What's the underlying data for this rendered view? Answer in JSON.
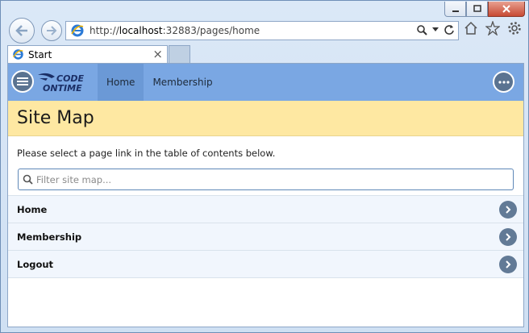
{
  "browser": {
    "url_prefix": "http://",
    "url_host": "localhost",
    "url_rest": ":32883/pages/home",
    "tab_title": "Start",
    "tab_close": "×"
  },
  "app": {
    "logo_line1": "CODE",
    "logo_line2": "ONTIME",
    "nav": [
      {
        "label": "Home",
        "active": true
      },
      {
        "label": "Membership",
        "active": false
      }
    ]
  },
  "page": {
    "title": "Site Map",
    "intro": "Please select a page link in the table of contents below.",
    "filter_placeholder": "Filter site map..."
  },
  "sitemap": [
    {
      "label": "Home"
    },
    {
      "label": "Membership"
    },
    {
      "label": "Logout"
    }
  ],
  "colors": {
    "app_bar": "#7aa7e3",
    "header_band": "#fee8a2",
    "list_bg": "#f1f6fd",
    "chevron": "#627a96"
  },
  "icons": [
    "back-arrow-icon",
    "forward-arrow-icon",
    "ie-logo-icon",
    "search-icon",
    "dropdown-icon",
    "refresh-icon",
    "home-icon",
    "favorites-star-icon",
    "settings-gear-icon",
    "hamburger-menu-icon",
    "more-options-icon",
    "chevron-right-icon"
  ]
}
